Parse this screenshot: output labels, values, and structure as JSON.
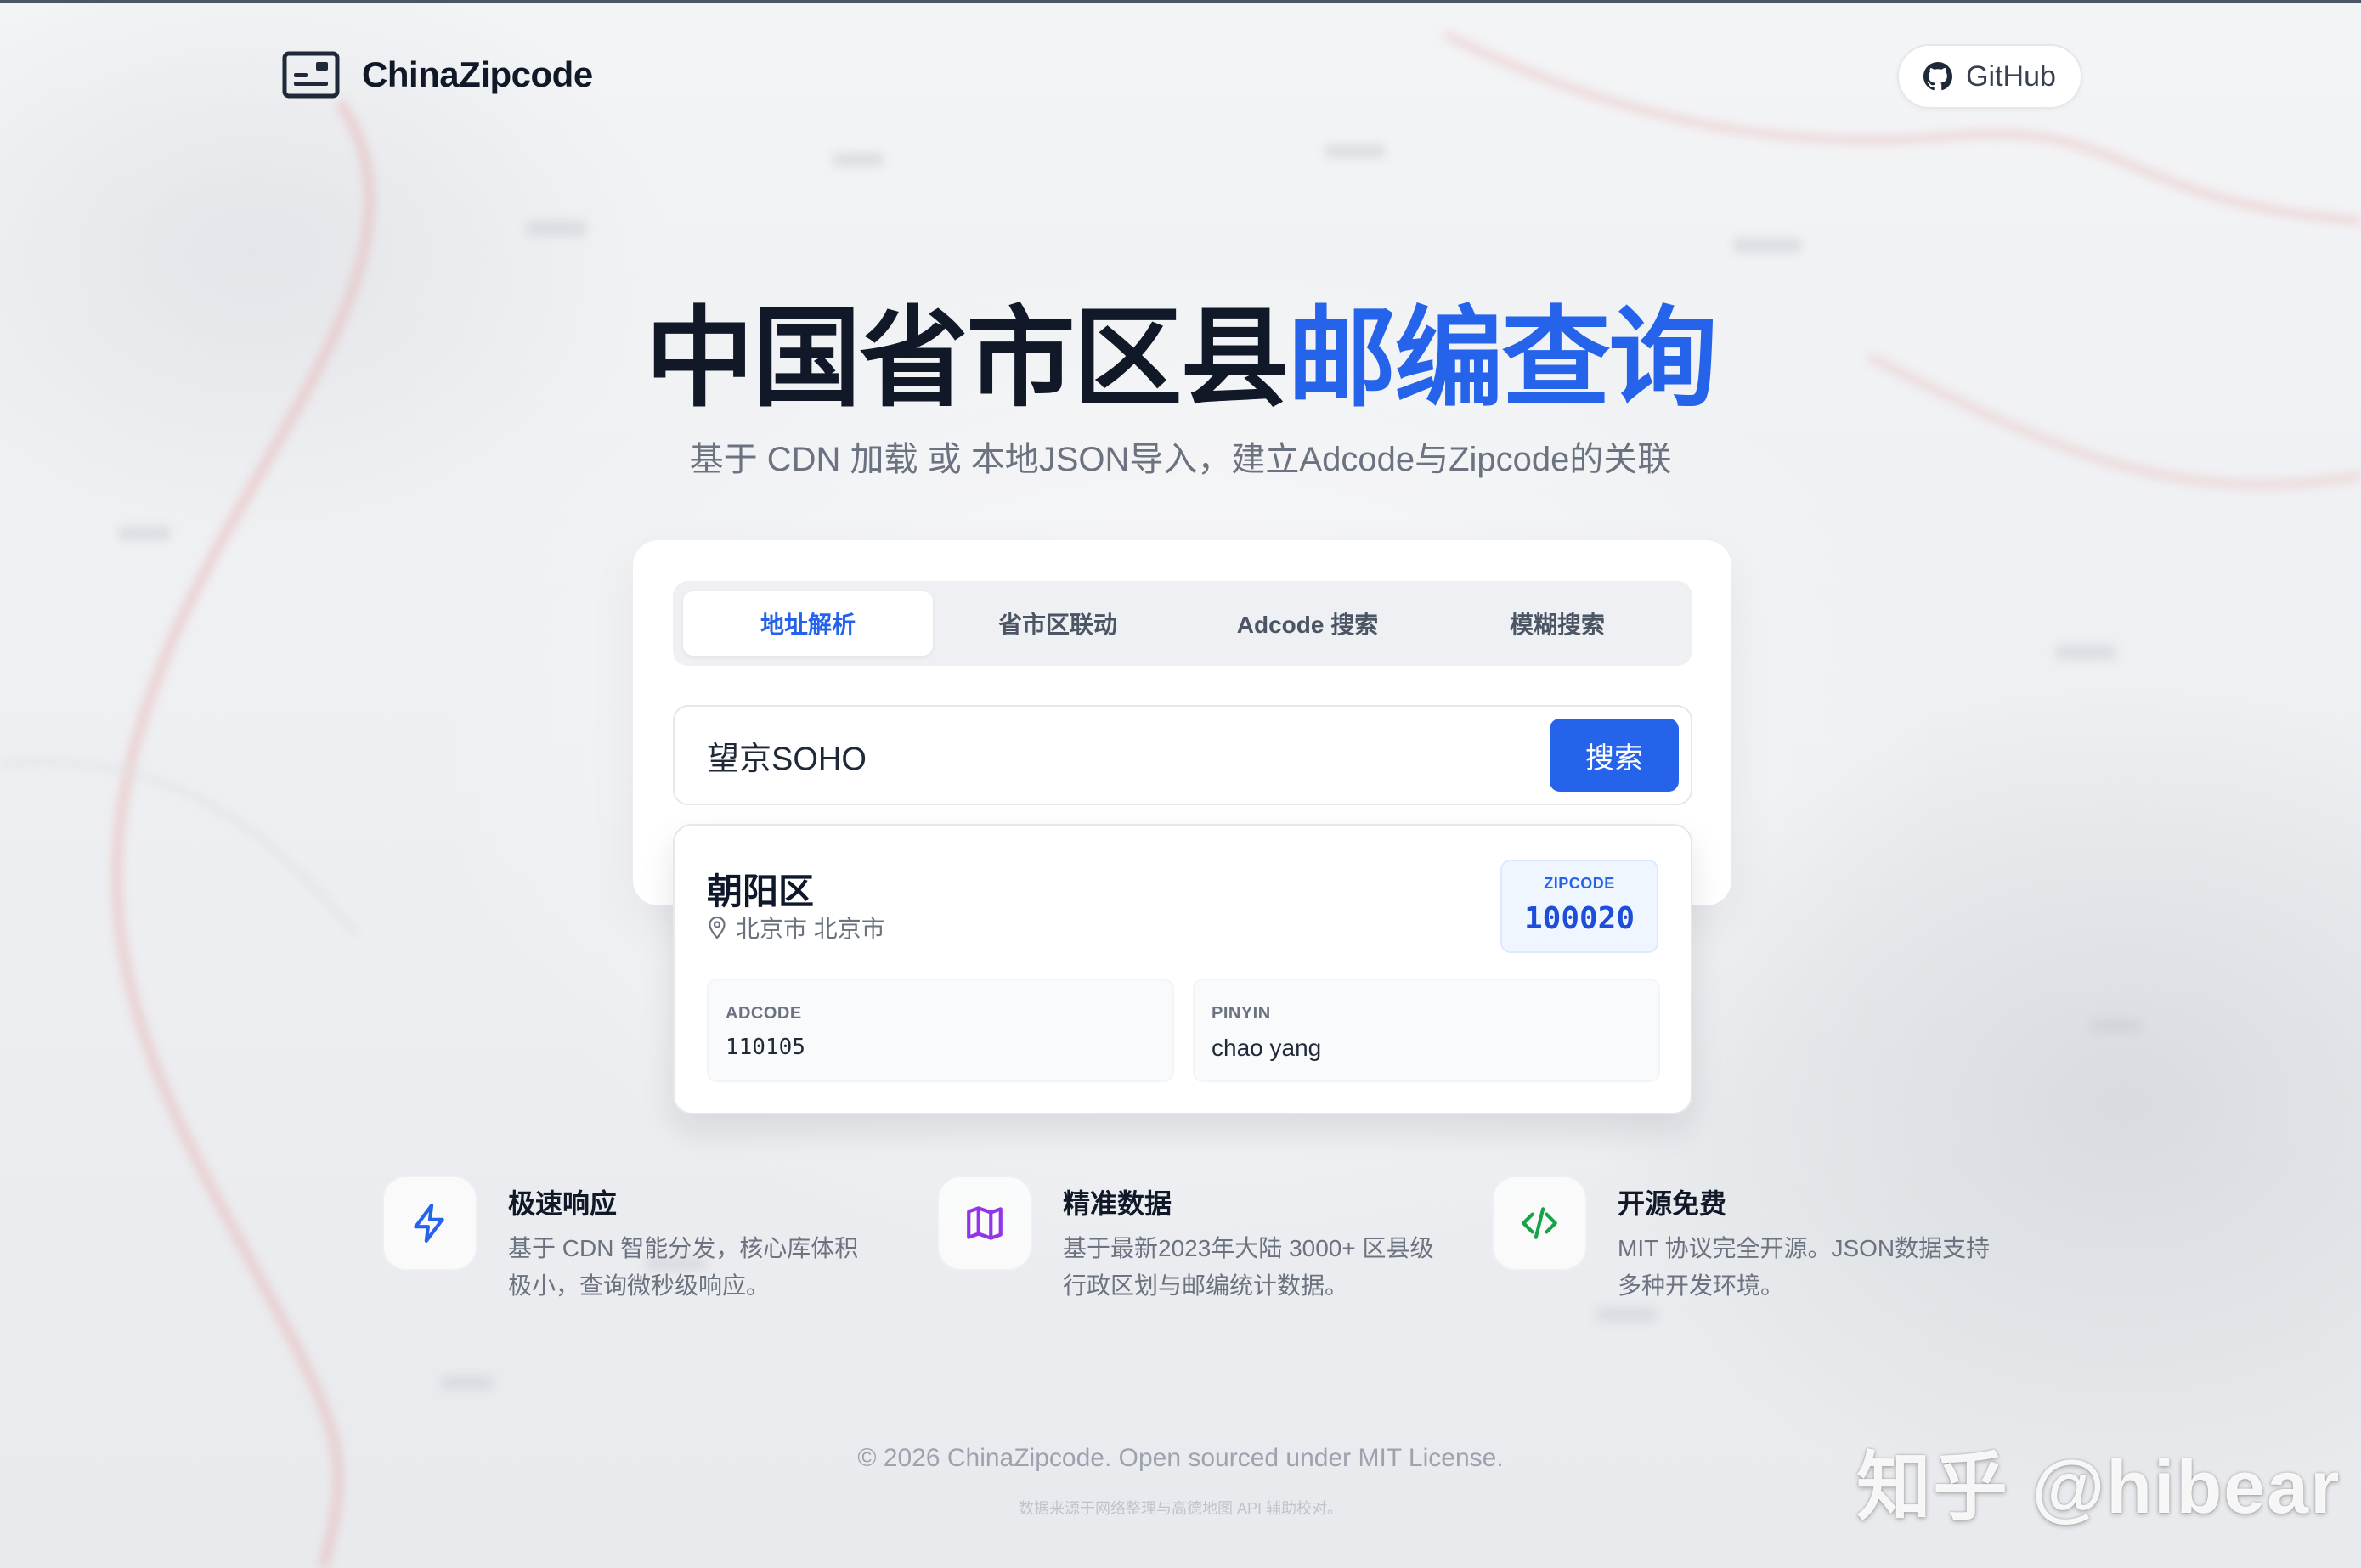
{
  "header": {
    "brand": "ChinaZipcode",
    "github_label": "GitHub"
  },
  "hero": {
    "title_dark": "中国省市区县",
    "title_accent": "邮编查询",
    "subtitle": "基于 CDN 加载 或 本地JSON导入，建立Adcode与Zipcode的关联"
  },
  "tabs": [
    {
      "label": "地址解析",
      "active": true
    },
    {
      "label": "省市区联动",
      "active": false
    },
    {
      "label": "Adcode 搜索",
      "active": false
    },
    {
      "label": "模糊搜索",
      "active": false
    }
  ],
  "search": {
    "value": "望京SOHO",
    "button_label": "搜索"
  },
  "result": {
    "district": "朝阳区",
    "location": "北京市 北京市",
    "zipcode_label": "ZIPCODE",
    "zipcode": "100020",
    "adcode_label": "ADCODE",
    "adcode": "110105",
    "pinyin_label": "PINYIN",
    "pinyin": "chao yang"
  },
  "features": [
    {
      "title": "极速响应",
      "desc": "基于 CDN 智能分发，核心库体积极小，查询微秒级响应。",
      "icon": "lightning-icon"
    },
    {
      "title": "精准数据",
      "desc": "基于最新2023年大陆 3000+ 区县级行政区划与邮编统计数据。",
      "icon": "map-icon"
    },
    {
      "title": "开源免费",
      "desc": "MIT 协议完全开源。JSON数据支持多种开发环境。",
      "icon": "code-icon"
    }
  ],
  "footer": {
    "main": "© 2026 ChinaZipcode. Open sourced under MIT License.",
    "sub": "数据来源于网络整理与高德地图 API 辅助校对。"
  },
  "watermark": "知乎 @hibear",
  "colors": {
    "accent": "#2563eb",
    "lightning": "#2563eb",
    "map": "#9333ea",
    "code": "#16a34a"
  }
}
